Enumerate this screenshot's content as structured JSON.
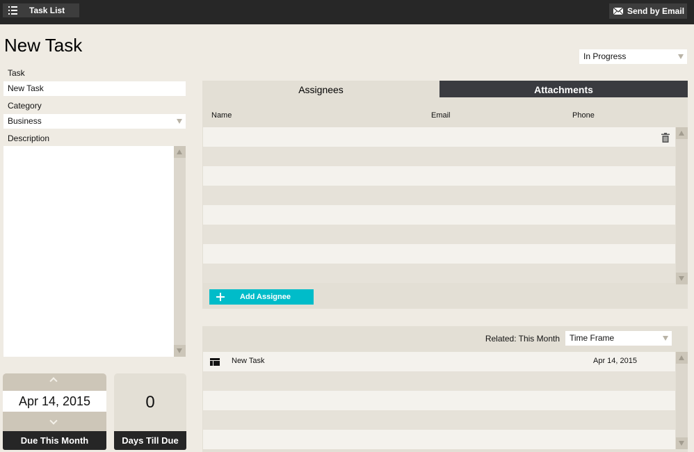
{
  "topbar": {
    "task_list_label": "Task List",
    "send_email_label": "Send by Email"
  },
  "page": {
    "title": "New Task"
  },
  "status": {
    "value": "In Progress"
  },
  "form": {
    "task_label": "Task",
    "task_value": "New Task",
    "category_label": "Category",
    "category_value": "Business",
    "description_label": "Description",
    "description_value": ""
  },
  "due": {
    "date": "Apr 14, 2015",
    "due_label": "Due This Month",
    "days_value": "0",
    "days_label": "Days Till Due"
  },
  "tabs": {
    "assignees": "Assignees",
    "attachments": "Attachments"
  },
  "assignees": {
    "columns": [
      "Name",
      "Email",
      "Phone"
    ],
    "rows": [],
    "add_label": "Add Assignee"
  },
  "related": {
    "label": "Related: This Month",
    "timeframe": "Time Frame",
    "items": [
      {
        "name": "New Task",
        "date": "Apr 14, 2015"
      }
    ]
  },
  "colors": {
    "background": "#efebe3",
    "topbar": "#272727",
    "accent": "#00bcc9",
    "tab_active": "#e3dfd5",
    "tab_inactive": "#3a3b40"
  }
}
